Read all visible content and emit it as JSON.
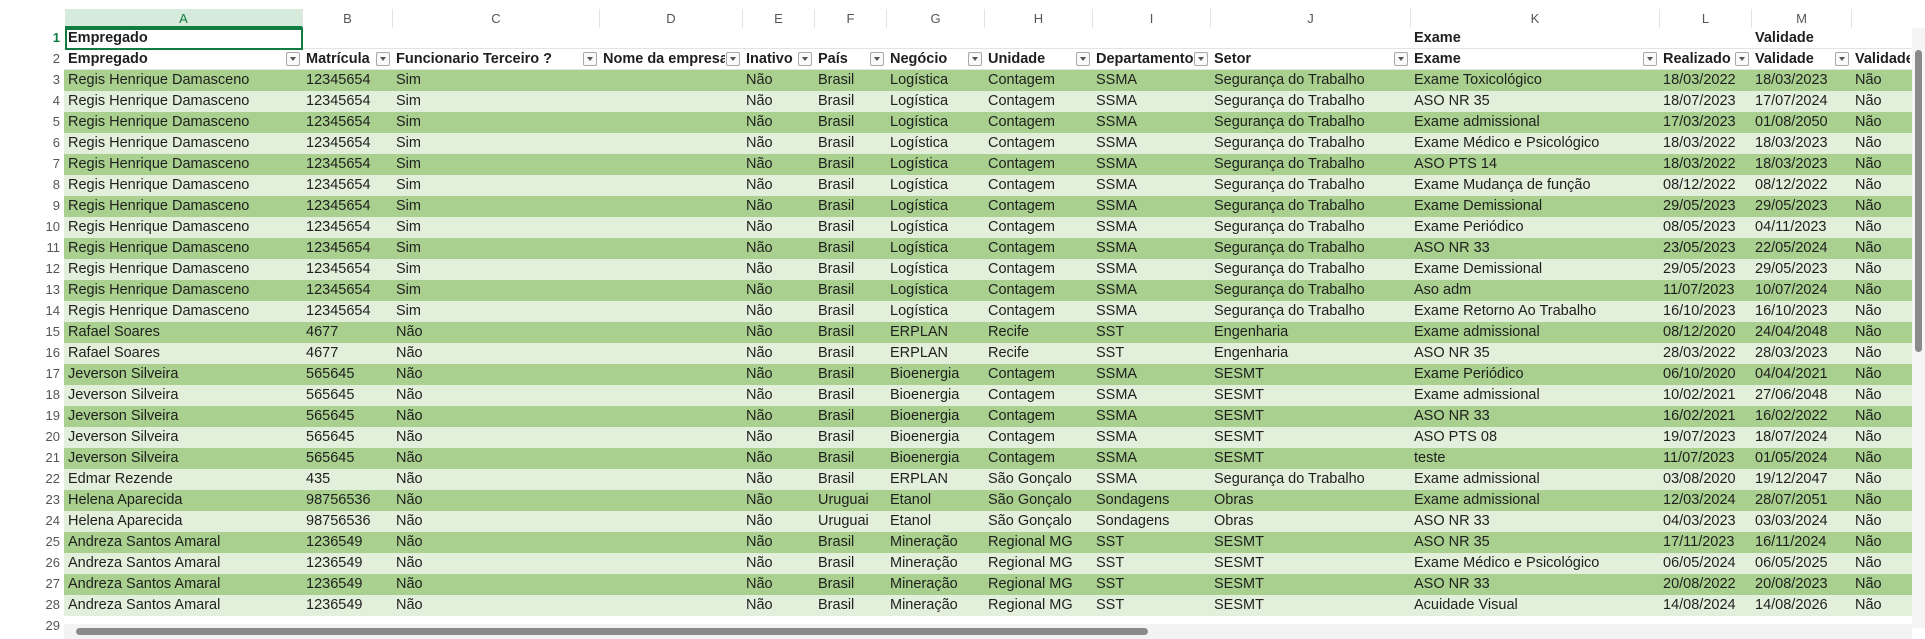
{
  "columns": [
    "A",
    "B",
    "C",
    "D",
    "E",
    "F",
    "G",
    "H",
    "I",
    "J",
    "K",
    "L",
    "M"
  ],
  "row_numbers": [
    "1",
    "2",
    "3",
    "4",
    "5",
    "6",
    "7",
    "8",
    "9",
    "10",
    "11",
    "12",
    "13",
    "14",
    "15",
    "16",
    "17",
    "18",
    "19",
    "20",
    "21",
    "22",
    "23",
    "24",
    "25",
    "26",
    "27",
    "28",
    "29"
  ],
  "row1": {
    "a": "Empregado",
    "k": "Exame",
    "m": "Validade"
  },
  "headers": {
    "a": "Empregado",
    "b": "Matrícula",
    "c": "Funcionario Terceiro ?",
    "d": "Nome da empresa",
    "e": "Inativo",
    "f": "País",
    "g": "Negócio",
    "h": "Unidade",
    "i": "Departamento",
    "j": "Setor",
    "k": "Exame",
    "l": "Realizado",
    "m": "Validade",
    "n": "Validade"
  },
  "rows": [
    [
      "Regis Henrique Damasceno",
      "12345654",
      "Sim",
      "",
      "Não",
      "Brasil",
      "Logística",
      "Contagem",
      "SSMA",
      "Segurança do Trabalho",
      "Exame Toxicológico",
      "18/03/2022",
      "18/03/2023",
      "Não"
    ],
    [
      "Regis Henrique Damasceno",
      "12345654",
      "Sim",
      "",
      "Não",
      "Brasil",
      "Logística",
      "Contagem",
      "SSMA",
      "Segurança do Trabalho",
      "ASO NR 35",
      "18/07/2023",
      "17/07/2024",
      "Não"
    ],
    [
      "Regis Henrique Damasceno",
      "12345654",
      "Sim",
      "",
      "Não",
      "Brasil",
      "Logística",
      "Contagem",
      "SSMA",
      "Segurança do Trabalho",
      "Exame admissional",
      "17/03/2023",
      "01/08/2050",
      "Não"
    ],
    [
      "Regis Henrique Damasceno",
      "12345654",
      "Sim",
      "",
      "Não",
      "Brasil",
      "Logística",
      "Contagem",
      "SSMA",
      "Segurança do Trabalho",
      "Exame Médico e Psicológico",
      "18/03/2022",
      "18/03/2023",
      "Não"
    ],
    [
      "Regis Henrique Damasceno",
      "12345654",
      "Sim",
      "",
      "Não",
      "Brasil",
      "Logística",
      "Contagem",
      "SSMA",
      "Segurança do Trabalho",
      "ASO PTS 14",
      "18/03/2022",
      "18/03/2023",
      "Não"
    ],
    [
      "Regis Henrique Damasceno",
      "12345654",
      "Sim",
      "",
      "Não",
      "Brasil",
      "Logística",
      "Contagem",
      "SSMA",
      "Segurança do Trabalho",
      "Exame Mudança de função",
      "08/12/2022",
      "08/12/2022",
      "Não"
    ],
    [
      "Regis Henrique Damasceno",
      "12345654",
      "Sim",
      "",
      "Não",
      "Brasil",
      "Logística",
      "Contagem",
      "SSMA",
      "Segurança do Trabalho",
      "Exame Demissional",
      "29/05/2023",
      "29/05/2023",
      "Não"
    ],
    [
      "Regis Henrique Damasceno",
      "12345654",
      "Sim",
      "",
      "Não",
      "Brasil",
      "Logística",
      "Contagem",
      "SSMA",
      "Segurança do Trabalho",
      "Exame Periódico",
      "08/05/2023",
      "04/11/2023",
      "Não"
    ],
    [
      "Regis Henrique Damasceno",
      "12345654",
      "Sim",
      "",
      "Não",
      "Brasil",
      "Logística",
      "Contagem",
      "SSMA",
      "Segurança do Trabalho",
      "ASO NR 33",
      "23/05/2023",
      "22/05/2024",
      "Não"
    ],
    [
      "Regis Henrique Damasceno",
      "12345654",
      "Sim",
      "",
      "Não",
      "Brasil",
      "Logística",
      "Contagem",
      "SSMA",
      "Segurança do Trabalho",
      "Exame Demissional",
      "29/05/2023",
      "29/05/2023",
      "Não"
    ],
    [
      "Regis Henrique Damasceno",
      "12345654",
      "Sim",
      "",
      "Não",
      "Brasil",
      "Logística",
      "Contagem",
      "SSMA",
      "Segurança do Trabalho",
      "Aso adm",
      "11/07/2023",
      "10/07/2024",
      "Não"
    ],
    [
      "Regis Henrique Damasceno",
      "12345654",
      "Sim",
      "",
      "Não",
      "Brasil",
      "Logística",
      "Contagem",
      "SSMA",
      "Segurança do Trabalho",
      "Exame Retorno Ao Trabalho",
      "16/10/2023",
      "16/10/2023",
      "Não"
    ],
    [
      "Rafael Soares",
      "4677",
      "Não",
      "",
      "Não",
      "Brasil",
      "ERPLAN",
      "Recife",
      "SST",
      "Engenharia",
      "Exame admissional",
      "08/12/2020",
      "24/04/2048",
      "Não"
    ],
    [
      "Rafael Soares",
      "4677",
      "Não",
      "",
      "Não",
      "Brasil",
      "ERPLAN",
      "Recife",
      "SST",
      "Engenharia",
      "ASO NR 35",
      "28/03/2022",
      "28/03/2023",
      "Não"
    ],
    [
      "Jeverson Silveira",
      "565645",
      "Não",
      "",
      "Não",
      "Brasil",
      "Bioenergia",
      "Contagem",
      "SSMA",
      "SESMT",
      "Exame Periódico",
      "06/10/2020",
      "04/04/2021",
      "Não"
    ],
    [
      "Jeverson Silveira",
      "565645",
      "Não",
      "",
      "Não",
      "Brasil",
      "Bioenergia",
      "Contagem",
      "SSMA",
      "SESMT",
      "Exame admissional",
      "10/02/2021",
      "27/06/2048",
      "Não"
    ],
    [
      "Jeverson Silveira",
      "565645",
      "Não",
      "",
      "Não",
      "Brasil",
      "Bioenergia",
      "Contagem",
      "SSMA",
      "SESMT",
      "ASO NR 33",
      "16/02/2021",
      "16/02/2022",
      "Não"
    ],
    [
      "Jeverson Silveira",
      "565645",
      "Não",
      "",
      "Não",
      "Brasil",
      "Bioenergia",
      "Contagem",
      "SSMA",
      "SESMT",
      "ASO PTS 08",
      "19/07/2023",
      "18/07/2024",
      "Não"
    ],
    [
      "Jeverson Silveira",
      "565645",
      "Não",
      "",
      "Não",
      "Brasil",
      "Bioenergia",
      "Contagem",
      "SSMA",
      "SESMT",
      "teste",
      "11/07/2023",
      "01/05/2024",
      "Não"
    ],
    [
      "Edmar Rezende",
      "435",
      "Não",
      "",
      "Não",
      "Brasil",
      "ERPLAN",
      "São Gonçalo",
      "SSMA",
      "Segurança do Trabalho",
      "Exame admissional",
      "03/08/2020",
      "19/12/2047",
      "Não"
    ],
    [
      "Helena Aparecida",
      "98756536",
      "Não",
      "",
      "Não",
      "Uruguai",
      "Etanol",
      "São Gonçalo",
      "Sondagens",
      "Obras",
      "Exame admissional",
      "12/03/2024",
      "28/07/2051",
      "Não"
    ],
    [
      "Helena Aparecida",
      "98756536",
      "Não",
      "",
      "Não",
      "Uruguai",
      "Etanol",
      "São Gonçalo",
      "Sondagens",
      "Obras",
      "ASO NR 33",
      "04/03/2023",
      "03/03/2024",
      "Não"
    ],
    [
      "Andreza Santos Amaral",
      "1236549",
      "Não",
      "",
      "Não",
      "Brasil",
      "Mineração",
      "Regional MG",
      "SST",
      "SESMT",
      "ASO NR 35",
      "17/11/2023",
      "16/11/2024",
      "Não"
    ],
    [
      "Andreza Santos Amaral",
      "1236549",
      "Não",
      "",
      "Não",
      "Brasil",
      "Mineração",
      "Regional MG",
      "SST",
      "SESMT",
      "Exame Médico e Psicológico",
      "06/05/2024",
      "06/05/2025",
      "Não"
    ],
    [
      "Andreza Santos Amaral",
      "1236549",
      "Não",
      "",
      "Não",
      "Brasil",
      "Mineração",
      "Regional MG",
      "SST",
      "SESMT",
      "ASO NR 33",
      "20/08/2022",
      "20/08/2023",
      "Não"
    ],
    [
      "Andreza Santos Amaral",
      "1236549",
      "Não",
      "",
      "Não",
      "Brasil",
      "Mineração",
      "Regional MG",
      "SST",
      "SESMT",
      "Acuidade Visual",
      "14/08/2024",
      "14/08/2026",
      "Não"
    ]
  ],
  "colors": {
    "band_dark": "#a9d08e",
    "band_light": "#e2efda",
    "selection": "#107c41"
  },
  "selected_cell": "A1"
}
